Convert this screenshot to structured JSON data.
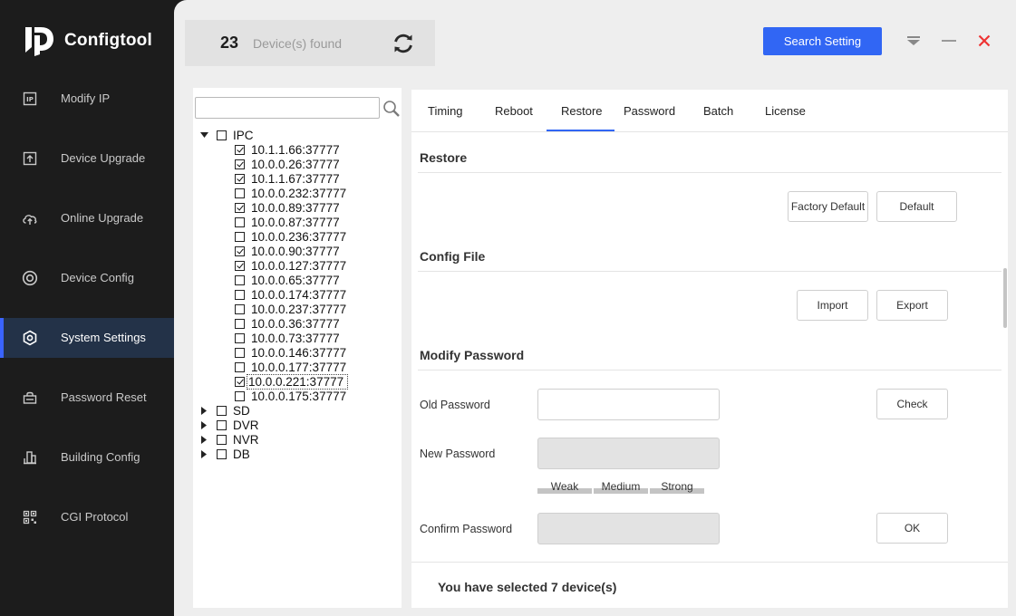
{
  "app": {
    "title": "Configtool"
  },
  "sidebar": {
    "items": [
      {
        "label": "Modify IP",
        "icon": "modify-ip-icon",
        "active": false
      },
      {
        "label": "Device Upgrade",
        "icon": "upload-box-icon",
        "active": false
      },
      {
        "label": "Online Upgrade",
        "icon": "cloud-upload-icon",
        "active": false
      },
      {
        "label": "Device Config",
        "icon": "target-icon",
        "active": false
      },
      {
        "label": "System Settings",
        "icon": "hex-gear-icon",
        "active": true
      },
      {
        "label": "Password Reset",
        "icon": "lock-box-icon",
        "active": false
      },
      {
        "label": "Building Config",
        "icon": "building-bars-icon",
        "active": false
      },
      {
        "label": "CGI Protocol",
        "icon": "qr-grid-icon",
        "active": false
      }
    ]
  },
  "header": {
    "device_count": "23",
    "device_found_label": "Device(s) found",
    "search_setting_label": "Search Setting",
    "accent": "#3166f4"
  },
  "tree": {
    "search_placeholder": "",
    "groups": [
      {
        "name": "IPC",
        "expanded": true,
        "checked": false,
        "devices": [
          {
            "address": "10.1.1.66:37777",
            "checked": true
          },
          {
            "address": "10.0.0.26:37777",
            "checked": true
          },
          {
            "address": "10.1.1.67:37777",
            "checked": true
          },
          {
            "address": "10.0.0.232:37777",
            "checked": false
          },
          {
            "address": "10.0.0.89:37777",
            "checked": true
          },
          {
            "address": "10.0.0.87:37777",
            "checked": false
          },
          {
            "address": "10.0.0.236:37777",
            "checked": false
          },
          {
            "address": "10.0.0.90:37777",
            "checked": true
          },
          {
            "address": "10.0.0.127:37777",
            "checked": true
          },
          {
            "address": "10.0.0.65:37777",
            "checked": false
          },
          {
            "address": "10.0.0.174:37777",
            "checked": false
          },
          {
            "address": "10.0.0.237:37777",
            "checked": false
          },
          {
            "address": "10.0.0.36:37777",
            "checked": false
          },
          {
            "address": "10.0.0.73:37777",
            "checked": false
          },
          {
            "address": "10.0.0.146:37777",
            "checked": false
          },
          {
            "address": "10.0.0.177:37777",
            "checked": false
          },
          {
            "address": "10.0.0.221:37777",
            "checked": true,
            "focused": true
          },
          {
            "address": "10.0.0.175:37777",
            "checked": false
          }
        ]
      },
      {
        "name": "SD",
        "expanded": false,
        "checked": false
      },
      {
        "name": "DVR",
        "expanded": false,
        "checked": false
      },
      {
        "name": "NVR",
        "expanded": false,
        "checked": false
      },
      {
        "name": "DB",
        "expanded": false,
        "checked": false
      }
    ]
  },
  "tabs": [
    {
      "label": "Timing",
      "active": false
    },
    {
      "label": "Reboot",
      "active": false
    },
    {
      "label": "Restore",
      "active": true
    },
    {
      "label": "Password",
      "active": false
    },
    {
      "label": "Batch",
      "active": false
    },
    {
      "label": "License",
      "active": false
    }
  ],
  "restore": {
    "title": "Restore",
    "factory_default_label": "Factory Default",
    "default_label": "Default"
  },
  "config_file": {
    "title": "Config File",
    "import_label": "Import",
    "export_label": "Export"
  },
  "modify_password": {
    "title": "Modify Password",
    "old_password_label": "Old Password",
    "old_password_value": "",
    "check_label": "Check",
    "new_password_label": "New Password",
    "new_password_value": "",
    "strength_levels": [
      "Weak",
      "Medium",
      "Strong"
    ],
    "confirm_password_label": "Confirm Password",
    "confirm_password_value": "",
    "ok_label": "OK"
  },
  "footer": {
    "selected_text": "You have selected 7 device(s)"
  }
}
